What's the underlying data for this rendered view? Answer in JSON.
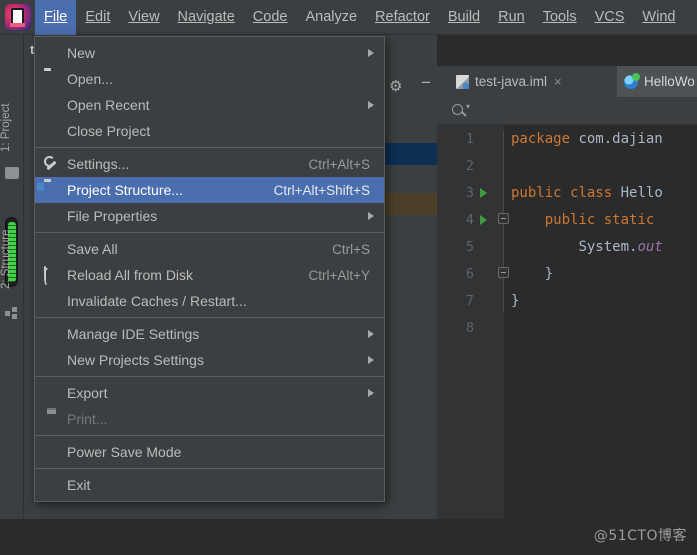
{
  "app": {
    "logo_icon": "intellij-idea-logo",
    "project_name_truncated": "tes",
    "watermark": "@51CTO博客"
  },
  "menubar": {
    "items": [
      {
        "label": "File",
        "mnemonic": "F",
        "active": true
      },
      {
        "label": "Edit",
        "mnemonic": "E",
        "active": false
      },
      {
        "label": "View",
        "mnemonic": "V",
        "active": false
      },
      {
        "label": "Navigate",
        "mnemonic": "N",
        "active": false
      },
      {
        "label": "Code",
        "mnemonic": "C",
        "active": false
      },
      {
        "label": "Analyze",
        "mnemonic": "z",
        "active": false
      },
      {
        "label": "Refactor",
        "mnemonic": "R",
        "active": false
      },
      {
        "label": "Build",
        "mnemonic": "B",
        "active": false
      },
      {
        "label": "Run",
        "mnemonic": "u",
        "active": false
      },
      {
        "label": "Tools",
        "mnemonic": "T",
        "active": false
      },
      {
        "label": "VCS",
        "mnemonic": "S",
        "active": false
      },
      {
        "label": "Wind",
        "mnemonic": "W",
        "active": false
      }
    ]
  },
  "file_menu": {
    "items": [
      {
        "label": "New",
        "accel": "",
        "submenu": true,
        "icon": "",
        "selected": false,
        "disabled": false
      },
      {
        "label": "Open...",
        "accel": "",
        "submenu": false,
        "icon": "folder-icon",
        "selected": false,
        "disabled": false
      },
      {
        "label": "Open Recent",
        "accel": "",
        "submenu": true,
        "icon": "",
        "selected": false,
        "disabled": false
      },
      {
        "label": "Close Project",
        "accel": "",
        "submenu": false,
        "icon": "",
        "selected": false,
        "disabled": false
      },
      {
        "separator": true
      },
      {
        "label": "Settings...",
        "accel": "Ctrl+Alt+S",
        "submenu": false,
        "icon": "wrench-icon",
        "selected": false,
        "disabled": false
      },
      {
        "label": "Project Structure...",
        "accel": "Ctrl+Alt+Shift+S",
        "submenu": false,
        "icon": "project-structure-icon",
        "selected": true,
        "disabled": false
      },
      {
        "label": "File Properties",
        "accel": "",
        "submenu": true,
        "icon": "",
        "selected": false,
        "disabled": false
      },
      {
        "separator": true
      },
      {
        "label": "Save All",
        "accel": "Ctrl+S",
        "submenu": false,
        "icon": "save-icon",
        "selected": false,
        "disabled": false
      },
      {
        "label": "Reload All from Disk",
        "accel": "Ctrl+Alt+Y",
        "submenu": false,
        "icon": "reload-icon",
        "selected": false,
        "disabled": false
      },
      {
        "label": "Invalidate Caches / Restart...",
        "accel": "",
        "submenu": false,
        "icon": "",
        "selected": false,
        "disabled": false
      },
      {
        "separator": true
      },
      {
        "label": "Manage IDE Settings",
        "accel": "",
        "submenu": true,
        "icon": "",
        "selected": false,
        "disabled": false
      },
      {
        "label": "New Projects Settings",
        "accel": "",
        "submenu": true,
        "icon": "",
        "selected": false,
        "disabled": false
      },
      {
        "separator": true
      },
      {
        "label": "Export",
        "accel": "",
        "submenu": true,
        "icon": "",
        "selected": false,
        "disabled": false
      },
      {
        "label": "Print...",
        "accel": "",
        "submenu": false,
        "icon": "print-icon",
        "selected": false,
        "disabled": true
      },
      {
        "separator": true
      },
      {
        "label": "Power Save Mode",
        "accel": "",
        "submenu": false,
        "icon": "",
        "selected": false,
        "disabled": false
      },
      {
        "separator": true
      },
      {
        "label": "Exit",
        "accel": "",
        "submenu": false,
        "icon": "",
        "selected": false,
        "disabled": false
      }
    ],
    "mnemonics": {
      "New": "N",
      "Open...": "O",
      "Open Recent": "R",
      "Settings...": "tt",
      "Save All": "S",
      "Print...": "P",
      "Exit": "x"
    }
  },
  "left_tool_window": {
    "tabs": [
      {
        "label": "1: Project"
      },
      {
        "label": "2: Structure"
      }
    ]
  },
  "editor_tabs": [
    {
      "label": "test-java.iml",
      "icon": "iml-file-icon",
      "active": false,
      "closable": true
    },
    {
      "label": "HelloWo",
      "icon": "java-class-icon",
      "active": true,
      "closable": false
    }
  ],
  "search": {
    "icon": "search-icon",
    "placeholder": ""
  },
  "code": {
    "lines": [
      {
        "num": "1",
        "run": false,
        "fold": "",
        "text": "package com.dajian"
      },
      {
        "num": "2",
        "run": false,
        "fold": "",
        "text": ""
      },
      {
        "num": "3",
        "run": true,
        "fold": "",
        "text": "public class Hello"
      },
      {
        "num": "4",
        "run": true,
        "fold": "open",
        "text": "    public static "
      },
      {
        "num": "5",
        "run": false,
        "fold": "",
        "text": "        System.out"
      },
      {
        "num": "6",
        "run": false,
        "fold": "close",
        "text": "    }"
      },
      {
        "num": "7",
        "run": false,
        "fold": "",
        "text": "}"
      },
      {
        "num": "8",
        "run": false,
        "fold": "",
        "text": ""
      }
    ],
    "keywords": [
      "package",
      "public",
      "class",
      "static"
    ]
  },
  "colors": {
    "menu_bg": "#3c3f41",
    "menu_selection": "#4b6eaf",
    "editor_bg": "#2b2b2b",
    "gutter_bg": "#313335",
    "text": "#bbbbbb",
    "keyword": "#cc7832",
    "field": "#9876aa",
    "run_marker": "#3f9c43"
  }
}
